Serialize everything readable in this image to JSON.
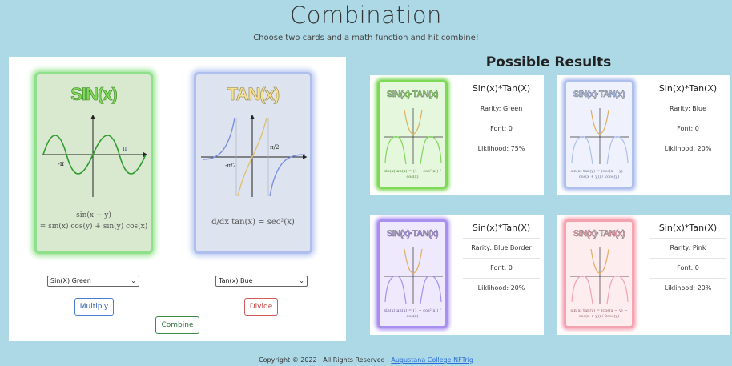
{
  "header": {
    "title": "Combination",
    "subtitle": "Choose two cards and a math function and hit combine!"
  },
  "cards": {
    "sin": {
      "title": "SIN(x)",
      "tick_label": "-π",
      "tick_label_right": "π",
      "formula_line1": "sin(x + y)",
      "formula_line2": "= sin(x) cos(y) + sin(y) cos(x)"
    },
    "tan": {
      "title": "TAN(x)",
      "tick_left": "-π/2",
      "tick_right": "π/2",
      "formula": "d/dx tan(x) = sec²(x)"
    }
  },
  "controls": {
    "select_left": "Sin(X) Green",
    "select_right": "Tan(x) Bue",
    "multiply_label": "Multiply",
    "divide_label": "Divide",
    "combine_label": "Combine"
  },
  "results": {
    "heading": "Possible Results",
    "items": [
      {
        "card_title": "SIN(x)·TAN(x)",
        "card_formula": "sin(x)tan(x) = (1 − cos²(x)) / cos(x)",
        "title": "Sin(x)*Tan(X)",
        "rarity": "Rarity: Green",
        "font": "Font: 0",
        "likelihood": "Liklihood: 75%",
        "color": "#7ed957"
      },
      {
        "card_title": "SIN(x)·TAN(x)",
        "card_formula": "sin(x) tan(y) = (cos(x − y) − cos(x + y)) / 2cos(y)",
        "title": "Sin(x)*Tan(X)",
        "rarity": "Rarity: Blue",
        "font": "Font: 0",
        "likelihood": "Liklihood: 20%",
        "color": "#aebfee"
      },
      {
        "card_title": "SIN(x)·TAN(x)",
        "card_formula": "sin(x)tan(x) = (1 − cos²(x)) / cos(x)",
        "title": "Sin(x)*Tan(X)",
        "rarity": "Rarity: Blue Border",
        "font": "Font: 0",
        "likelihood": "Liklihood: 20%",
        "color": "#a98ff0"
      },
      {
        "card_title": "SIN(x)·TAN(x)",
        "card_formula": "sin(x) tan(y) = (cos(x − y) − cos(x + y)) / 2cos(y)",
        "title": "Sin(x)*Tan(X)",
        "rarity": "Rarity: Pink",
        "font": "Font: 0",
        "likelihood": "Liklihood: 20%",
        "color": "#f4a3b1"
      }
    ]
  },
  "footer": {
    "text": "Copyright © 2022 · All Rights Reserved · ",
    "link": "Augustana College NFTrig"
  }
}
